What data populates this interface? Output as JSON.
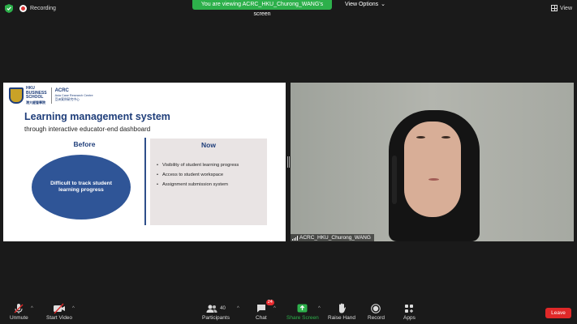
{
  "top": {
    "recording": "Recording",
    "viewing_banner": "You are viewing ACRC_HKU_Churong_WANG's screen",
    "view_options": "View Options",
    "view_toggle": "View"
  },
  "slide": {
    "logo_text": [
      "HKU",
      "BUSINESS",
      "SCHOOL",
      "港大經管學院"
    ],
    "acrc_title": "ACRC",
    "acrc_line1": "Asia Case Research Centre",
    "acrc_line2": "亞洲案例研究中心",
    "title": "Learning management system",
    "subtitle": "through interactive educator-end dashboard",
    "before_heading": "Before",
    "before_text": "Difficult to track student learning progress",
    "now_heading": "Now",
    "now_items": [
      "Visibility of student learning progress",
      "Access to student workspace",
      "Assignment submission system"
    ]
  },
  "video": {
    "participant_name": "ACRC_HKU_Churong_WANG"
  },
  "toolbar": {
    "unmute": "Unmute",
    "start_video": "Start Video",
    "participants": "Participants",
    "participants_count": "40",
    "chat": "Chat",
    "chat_badge": "24",
    "share_screen": "Share Screen",
    "raise_hand": "Raise Hand",
    "record": "Record",
    "apps": "Apps",
    "leave": "Leave"
  },
  "colors": {
    "banner_green": "#2db04b",
    "share_green": "#2db04b",
    "leave_red": "#e02828",
    "slide_blue": "#1f3e7a",
    "ellipse_blue": "#2f5597"
  }
}
